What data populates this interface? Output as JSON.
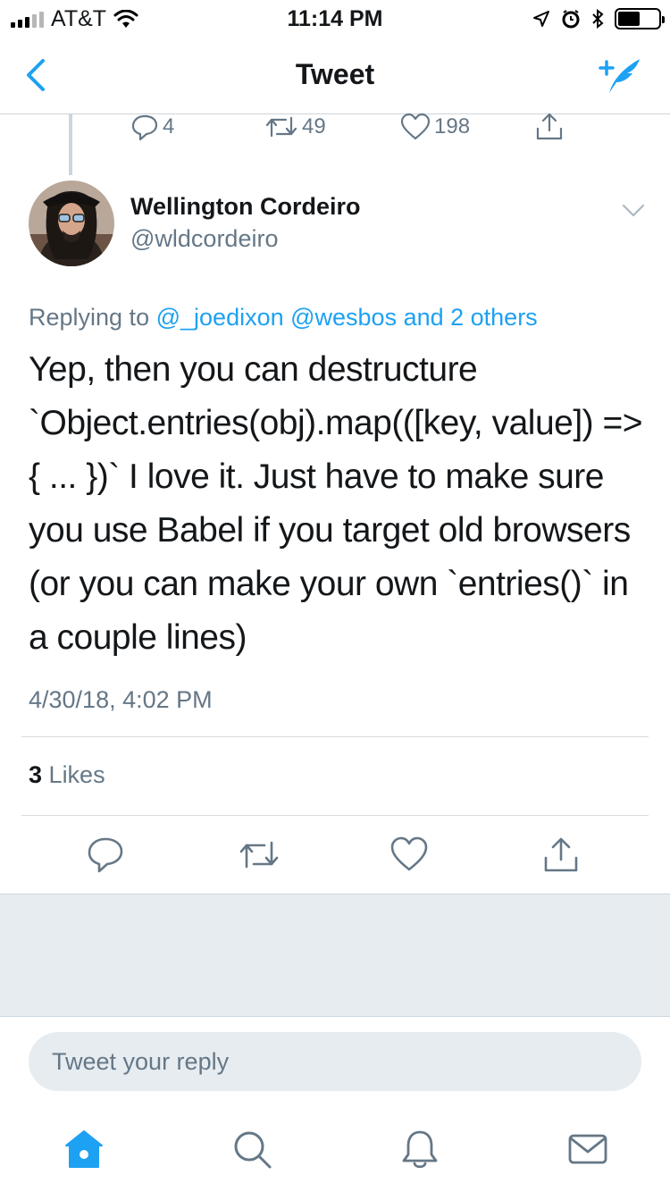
{
  "status_bar": {
    "carrier": "AT&T",
    "time": "11:14 PM"
  },
  "nav": {
    "title": "Tweet",
    "back_icon": "chevron-left-icon",
    "compose_icon": "compose-quill-icon"
  },
  "parent_actions": {
    "replies": "4",
    "retweets": "49",
    "likes": "198"
  },
  "author": {
    "name": "Wellington Cordeiro",
    "handle": "@wldcordeiro"
  },
  "tweet": {
    "replying_prefix": "Replying to",
    "replying_links": "@_joedixon @wesbos and 2 others",
    "text": "Yep, then you can destructure `Object.entries(obj).map(([key, value]) => { ... })` I love it. Just have to make sure you use Babel if you target old browsers (or you can make your own `entries()` in a couple lines)",
    "timestamp": "4/30/18, 4:02 PM",
    "likes_count": "3",
    "likes_label": "Likes"
  },
  "reply": {
    "placeholder": "Tweet your reply"
  },
  "tabs": [
    "home-icon",
    "search-icon",
    "notifications-icon",
    "messages-icon"
  ],
  "colors": {
    "accent": "#1da1f2",
    "muted": "#657786",
    "text": "#14171a",
    "divider": "#e6ecf0"
  }
}
